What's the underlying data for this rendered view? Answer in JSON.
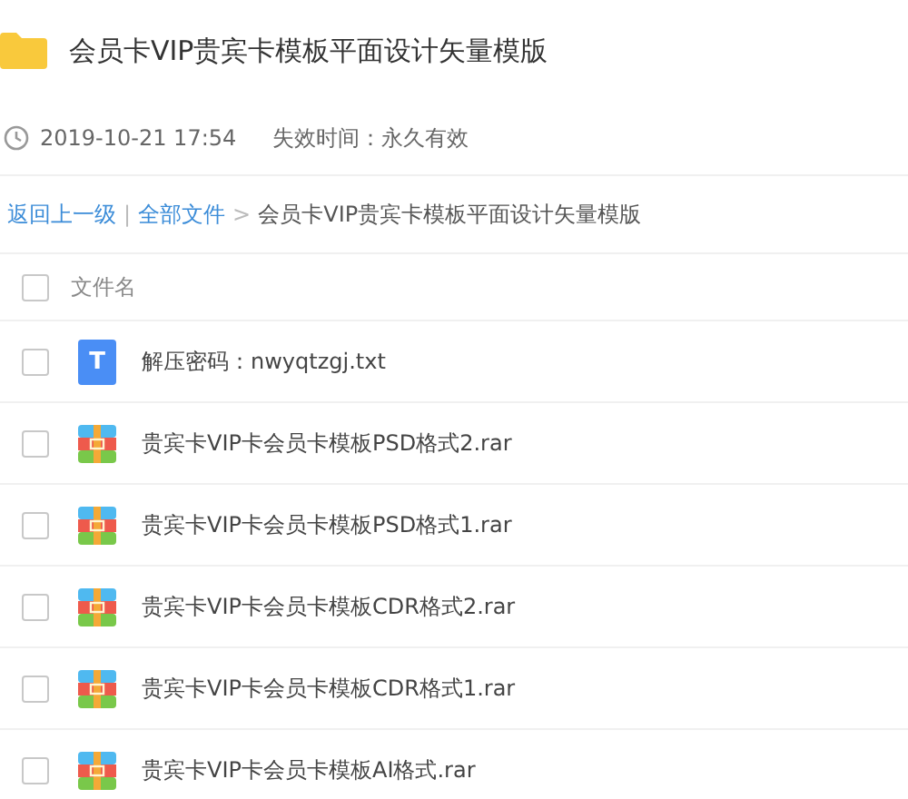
{
  "title": "会员卡VIP贵宾卡模板平面设计矢量模版",
  "meta": {
    "date": "2019-10-21 17:54",
    "expiry": "失效时间：永久有效"
  },
  "breadcrumb": {
    "back": "返回上一级",
    "separator": "|",
    "all": "全部文件",
    "arrow": ">",
    "current": "会员卡VIP贵宾卡模板平面设计矢量模版"
  },
  "table": {
    "header": {
      "label": "文件名",
      "checked": false
    },
    "rows": [
      {
        "kind": "text",
        "name": "解压密码：nwyqtzgj.txt",
        "checked": false,
        "icon_letter": "T"
      },
      {
        "kind": "archive",
        "name": "贵宾卡VIP卡会员卡模板PSD格式2.rar",
        "checked": false
      },
      {
        "kind": "archive",
        "name": "贵宾卡VIP卡会员卡模板PSD格式1.rar",
        "checked": false
      },
      {
        "kind": "archive",
        "name": "贵宾卡VIP卡会员卡模板CDR格式2.rar",
        "checked": false
      },
      {
        "kind": "archive",
        "name": "贵宾卡VIP卡会员卡模板CDR格式1.rar",
        "checked": false
      },
      {
        "kind": "archive",
        "name": "贵宾卡VIP卡会员卡模板AI格式.rar",
        "checked": false
      }
    ]
  }
}
